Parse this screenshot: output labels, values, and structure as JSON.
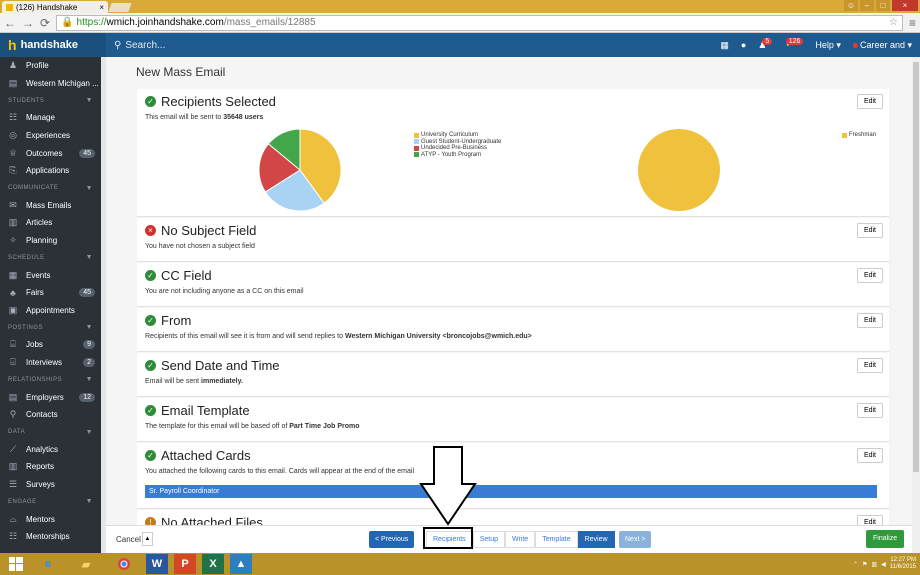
{
  "browser": {
    "tab_title": "(126) Handshake",
    "url_scheme": "https://",
    "url_host": "wmich.joinhandshake.com",
    "url_path": "/mass_emails/12885"
  },
  "header": {
    "brand": "handshake",
    "search_placeholder": "Search...",
    "notif_count": "5",
    "alerts_count": "126",
    "help_label": "Help ▾",
    "user_label": "Career and ▾"
  },
  "sidebar": {
    "top_items": [
      {
        "label": "Profile",
        "icon": "person-icon"
      },
      {
        "label": "Western Michigan ...",
        "icon": "document-icon"
      }
    ],
    "sections": [
      {
        "title": "STUDENTS",
        "items": [
          {
            "label": "Manage",
            "count": ""
          },
          {
            "label": "Experiences",
            "count": ""
          },
          {
            "label": "Outcomes",
            "count": "45"
          },
          {
            "label": "Applications",
            "count": ""
          }
        ]
      },
      {
        "title": "COMMUNICATE",
        "items": [
          {
            "label": "Mass Emails",
            "count": ""
          },
          {
            "label": "Articles",
            "count": ""
          },
          {
            "label": "Planning",
            "count": ""
          }
        ]
      },
      {
        "title": "SCHEDULE",
        "items": [
          {
            "label": "Events",
            "count": ""
          },
          {
            "label": "Fairs",
            "count": "45"
          },
          {
            "label": "Appointments",
            "count": ""
          }
        ]
      },
      {
        "title": "POSTINGS",
        "items": [
          {
            "label": "Jobs",
            "count": "9"
          },
          {
            "label": "Interviews",
            "count": "2"
          }
        ]
      },
      {
        "title": "RELATIONSHIPS",
        "items": [
          {
            "label": "Employers",
            "count": "12"
          },
          {
            "label": "Contacts",
            "count": ""
          }
        ]
      },
      {
        "title": "DATA",
        "items": [
          {
            "label": "Analytics",
            "count": ""
          },
          {
            "label": "Reports",
            "count": ""
          },
          {
            "label": "Surveys",
            "count": ""
          }
        ]
      },
      {
        "title": "ENGAGE",
        "items": [
          {
            "label": "Mentors",
            "count": ""
          },
          {
            "label": "Mentorships",
            "count": ""
          }
        ]
      }
    ]
  },
  "main": {
    "page_title": "New Mass Email",
    "edit_label": "Edit",
    "recipients": {
      "title": "Recipients Selected",
      "desc_prefix": "This email will be sent to ",
      "desc_count": "35648 users"
    },
    "subject": {
      "title": "No Subject Field",
      "desc": "You have not chosen a subject field"
    },
    "cc": {
      "title": "CC Field",
      "desc": "You are not including anyone as a CC on this email"
    },
    "from": {
      "title": "From",
      "desc_prefix": "Recipients of this email will see it is from and will send replies to ",
      "desc_bold": "Western Michigan University <broncojobs@wmich.edu>"
    },
    "send": {
      "title": "Send Date and Time",
      "desc_prefix": "Email will be sent ",
      "desc_bold": "immediately."
    },
    "template": {
      "title": "Email Template",
      "desc_prefix": "The template for this email will be based off of ",
      "desc_bold": "Part Time Job Promo"
    },
    "cards": {
      "title": "Attached Cards",
      "desc": "You attached the following cards to this email. Cards will appear at the end of the email",
      "card_label": "Sr. Payroll Coordinator"
    },
    "files": {
      "title": "No Attached Files"
    }
  },
  "chart_data": [
    {
      "type": "pie",
      "categories": [
        "University Curriculum",
        "Guest Student-Undergraduate",
        "Undecided Pre-Business",
        "ATYP - Youth Program"
      ],
      "values": [
        40,
        26,
        20,
        14
      ],
      "colors": [
        "#efc13c",
        "#a9d3f5",
        "#d34647",
        "#43a649"
      ],
      "legend": "right"
    },
    {
      "type": "pie",
      "categories": [
        "Freshman"
      ],
      "values": [
        100
      ],
      "colors": [
        "#efc13c"
      ],
      "legend": "right"
    }
  ],
  "footer": {
    "cancel": "Cancel",
    "previous": "< Previous",
    "steps": [
      {
        "label": "Recipients",
        "active": false
      },
      {
        "label": "Setup",
        "active": false
      },
      {
        "label": "Write",
        "active": false
      },
      {
        "label": "Template",
        "active": false
      },
      {
        "label": "Review",
        "active": true
      }
    ],
    "next": "Next >",
    "finalize": "Finalize"
  },
  "taskbar": {
    "time": "12:27 PM",
    "date": "11/6/2015"
  }
}
